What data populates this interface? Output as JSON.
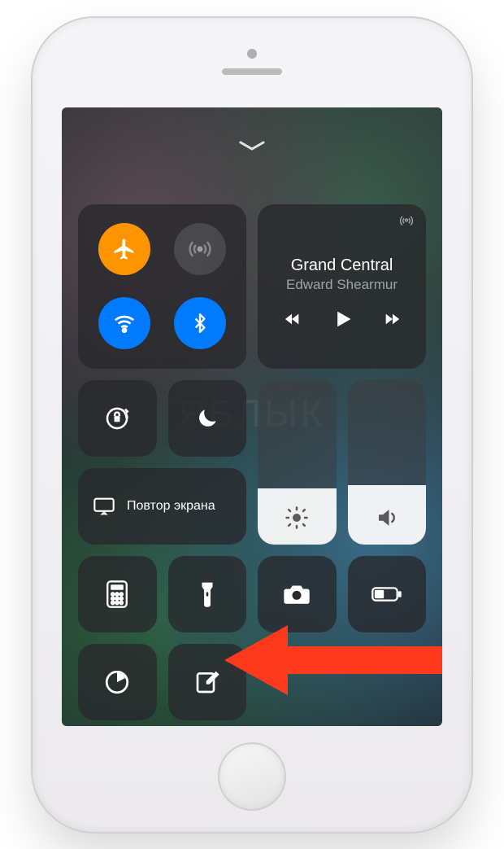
{
  "music": {
    "title": "Grand Central",
    "artist": "Edward Shearmur"
  },
  "screen_mirroring_label": "Повтор экрана",
  "watermark": "ЯБЛЫК",
  "colors": {
    "airplane_on": "#ff9500",
    "wifi_on": "#007aff",
    "bluetooth_on": "#007aff",
    "annotation_arrow": "#ff3b1f"
  },
  "sliders": {
    "brightness_percent": 34,
    "volume_percent": 36
  },
  "connectivity": {
    "airplane_mode": true,
    "cellular": false,
    "wifi": true,
    "bluetooth": true
  },
  "toggles": {
    "orientation_lock": false,
    "do_not_disturb": false
  },
  "shortcut_tiles": [
    "calculator",
    "flashlight",
    "camera",
    "low-power-mode",
    "timer",
    "notes"
  ],
  "annotation": {
    "target": "notes-tile"
  }
}
